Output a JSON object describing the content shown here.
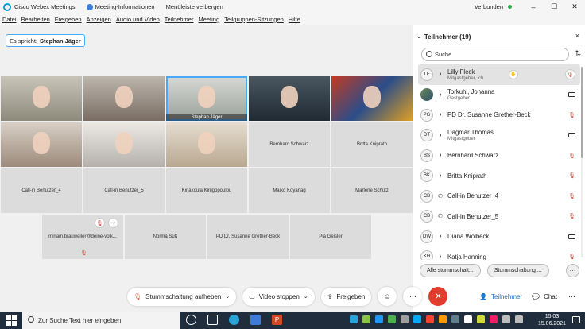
{
  "titlebar": {
    "app_title": "Cisco Webex Meetings",
    "meeting_info": "Meeting-Informationen",
    "hide_menu": "Menüleiste verbergen",
    "connection_status": "Verbunden",
    "status_color": "#2bb24c"
  },
  "menubar": {
    "items": [
      "Datei",
      "Bearbeiten",
      "Freigeben",
      "Anzeigen",
      "Audio und Video",
      "Teilnehmer",
      "Meeting",
      "Teilgruppen-Sitzungen",
      "Hilfe"
    ]
  },
  "speaker": {
    "label": "Es spricht:",
    "name": "Stephan Jäger"
  },
  "grid": {
    "row1": [
      {
        "name": "",
        "video": true
      },
      {
        "name": "",
        "video": true
      },
      {
        "name": "Stephan Jäger",
        "video": true
      },
      {
        "name": "",
        "video": true
      },
      {
        "name": "",
        "video": true
      }
    ],
    "row2": [
      {
        "name": "",
        "video": true
      },
      {
        "name": "",
        "video": true
      },
      {
        "name": "",
        "video": true
      },
      {
        "name": "Bernhard Schwarz",
        "video": false
      },
      {
        "name": "Britta Kniprath",
        "video": false
      }
    ],
    "row3": [
      {
        "name": "Call-in Benutzer_4",
        "video": false
      },
      {
        "name": "Call-in Benutzer_5",
        "video": false
      },
      {
        "name": "Kiriakoula Kinigopoulou",
        "video": false
      },
      {
        "name": "Maiko Koyanag",
        "video": false
      },
      {
        "name": "Marlene Schütz",
        "video": false
      }
    ],
    "row4": [
      {
        "name": "miriam.brauweiler@deine-volk...",
        "video": false
      },
      {
        "name": "Norma Süß",
        "video": false
      },
      {
        "name": "PD Dr. Susanne Grether-Beck",
        "video": false
      },
      {
        "name": "Pia Geisler",
        "video": false
      }
    ],
    "more_label": "···"
  },
  "panel": {
    "title": "Teilnehmer (19)",
    "close_icon": "×",
    "search_placeholder": "Suche",
    "participants": [
      {
        "initials": "LF",
        "name": "Lilly Fleck",
        "sub": "Mitgastgeber, ich",
        "status": "muted",
        "hand": true,
        "selected": true
      },
      {
        "initials": "",
        "name": "Torkuhl, Johanna",
        "sub": "Gastgeber",
        "status": "camera",
        "hand": false,
        "selected": false
      },
      {
        "initials": "PG",
        "name": "PD Dr. Susanne Grether-Beck",
        "sub": "",
        "status": "muted",
        "hand": false,
        "selected": false
      },
      {
        "initials": "DT",
        "name": "Dagmar Thomas",
        "sub": "Mitgastgeber",
        "status": "camera",
        "hand": false,
        "selected": false
      },
      {
        "initials": "BS",
        "name": "Bernhard Schwarz",
        "sub": "",
        "status": "muted",
        "hand": false,
        "selected": false
      },
      {
        "initials": "BK",
        "name": "Britta Kniprath",
        "sub": "",
        "status": "muted",
        "hand": false,
        "selected": false
      },
      {
        "initials": "CB",
        "name": "Call-in Benutzer_4",
        "sub": "",
        "status": "muted",
        "hand": false,
        "selected": false
      },
      {
        "initials": "CB",
        "name": "Call-in Benutzer_5",
        "sub": "",
        "status": "muted",
        "hand": false,
        "selected": false
      },
      {
        "initials": "DW",
        "name": "Diana Wolbeck",
        "sub": "",
        "status": "camera",
        "hand": false,
        "selected": false
      },
      {
        "initials": "KH",
        "name": "Katja Hanning",
        "sub": "",
        "status": "muted",
        "hand": false,
        "selected": false
      }
    ],
    "mute_all": "Alle stummschalt...",
    "mute_options": "Stummschaltung ...",
    "more": "···"
  },
  "controls": {
    "unmute": "Stummschaltung aufheben",
    "stop_video": "Video stoppen",
    "share": "Freigeben",
    "participants": "Teilnehmer",
    "chat": "Chat"
  },
  "taskbar": {
    "search_placeholder": "Zur Suche Text hier eingeben",
    "time": "15:03",
    "date": "15.06.2021"
  }
}
